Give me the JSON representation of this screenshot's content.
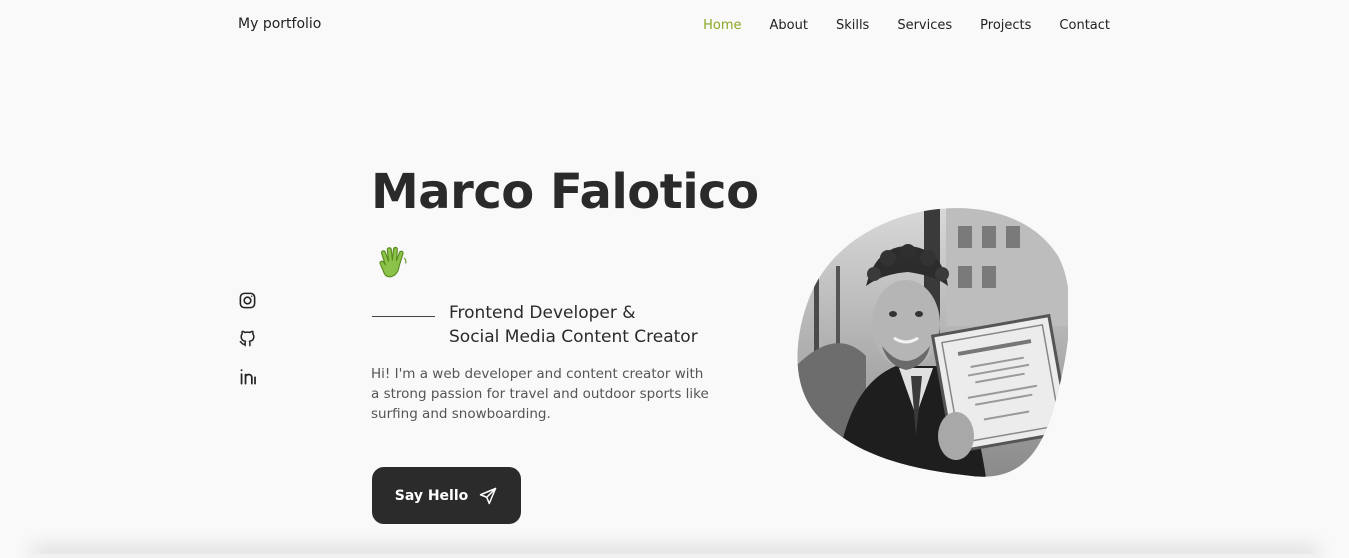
{
  "header": {
    "logo": "My portfolio",
    "nav": [
      {
        "label": "Home",
        "active": true
      },
      {
        "label": "About",
        "active": false
      },
      {
        "label": "Skills",
        "active": false
      },
      {
        "label": "Services",
        "active": false
      },
      {
        "label": "Projects",
        "active": false
      },
      {
        "label": "Contact",
        "active": false
      }
    ]
  },
  "social": [
    {
      "icon": "instagram-icon"
    },
    {
      "icon": "github-icon"
    },
    {
      "icon": "linkedin-icon"
    }
  ],
  "hero": {
    "name": "Marco Falotico",
    "subtitle_line1": "Frontend Developer &",
    "subtitle_line2": "Social Media Content Creator",
    "description": "Hi! I'm a web developer and content creator with a strong passion for travel and outdoor sports like surfing and snowboarding.",
    "button_label": "Say Hello"
  },
  "colors": {
    "accent": "#8aa824",
    "dark": "#2b2b2b",
    "background": "#f9f9f9"
  }
}
